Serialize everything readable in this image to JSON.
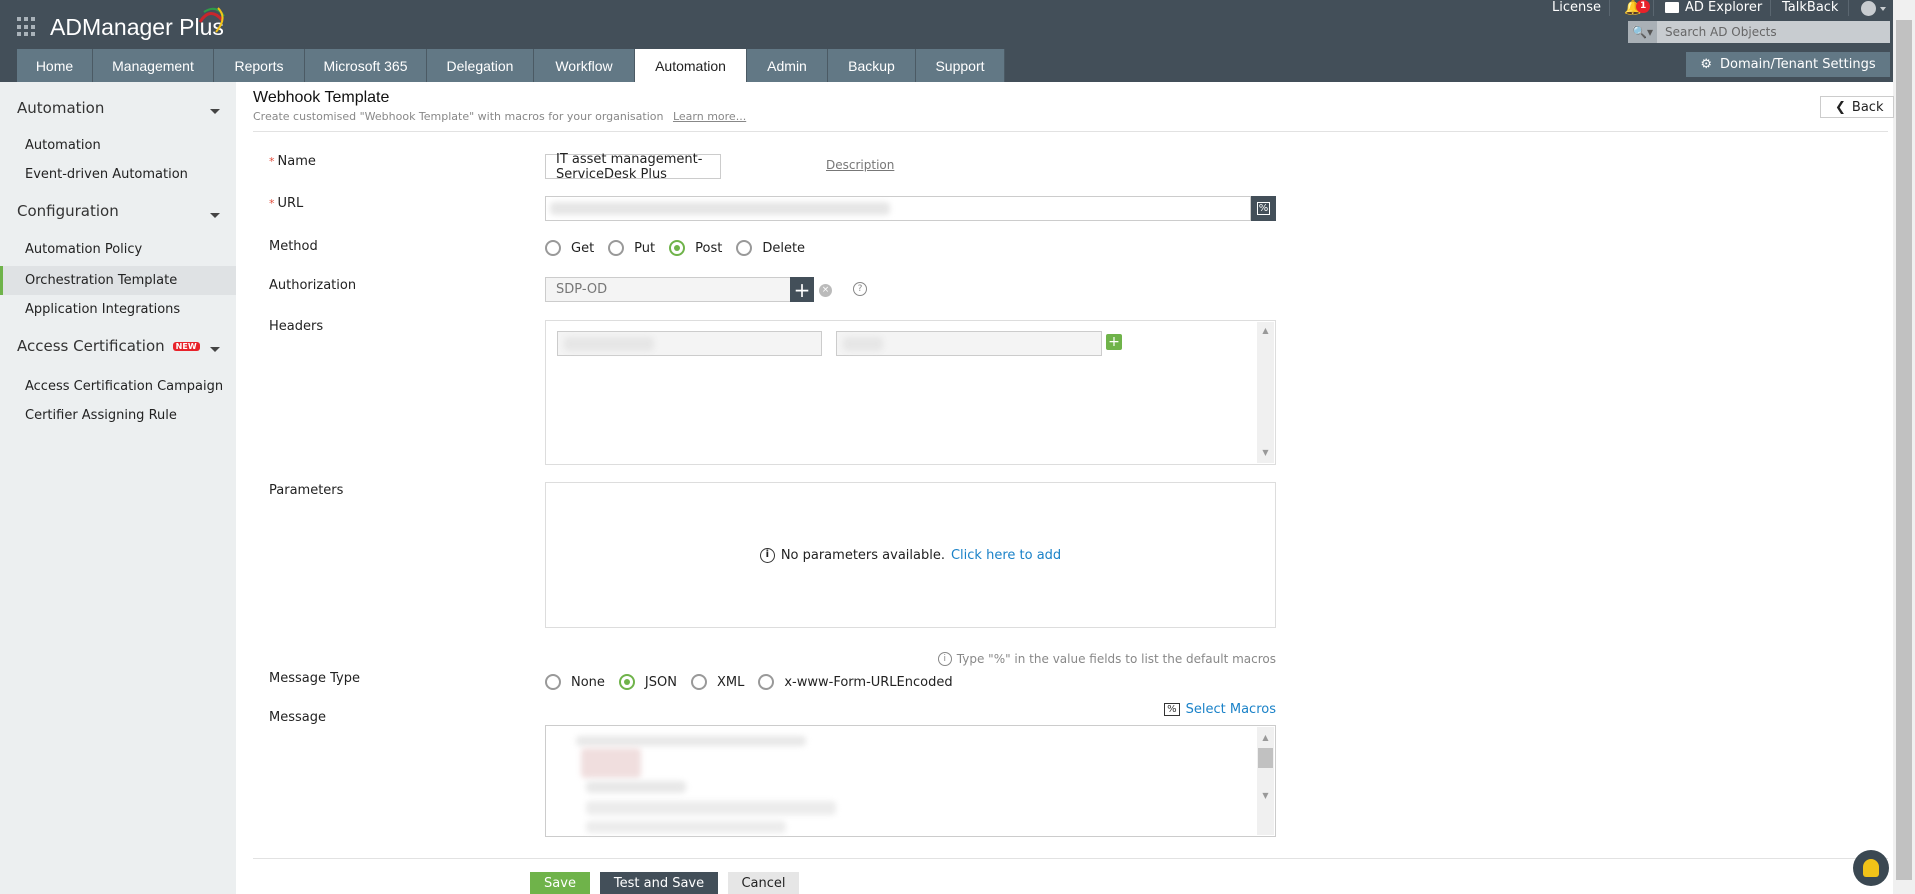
{
  "app": {
    "name": "ADManager Plus"
  },
  "top_links": {
    "license": "License",
    "notification_count": "1",
    "ad_explorer": "AD Explorer",
    "talkback": "TalkBack"
  },
  "search": {
    "placeholder": "Search AD Objects"
  },
  "domain_settings": "Domain/Tenant Settings",
  "tabs": [
    "Home",
    "Management",
    "Reports",
    "Microsoft 365",
    "Delegation",
    "Workflow",
    "Automation",
    "Admin",
    "Backup",
    "Support"
  ],
  "active_tab": "Automation",
  "sidebar": {
    "sections": [
      {
        "title": "Automation",
        "items": [
          "Automation",
          "Event-driven Automation"
        ]
      },
      {
        "title": "Configuration",
        "items": [
          "Automation Policy",
          "Orchestration Template",
          "Application Integrations"
        ]
      },
      {
        "title": "Access Certification",
        "badge": "NEW",
        "items": [
          "Access Certification Campaign",
          "Certifier Assigning Rule"
        ]
      }
    ],
    "active_item": "Orchestration Template"
  },
  "page": {
    "title": "Webhook Template",
    "subtitle": "Create customised \"Webhook Template\" with macros for your organisation",
    "learn_more": "Learn more...",
    "back": "Back"
  },
  "form": {
    "name_label": "Name",
    "name_value": "IT asset management-ServiceDesk Plus",
    "description_link": "Description",
    "url_label": "URL",
    "method_label": "Method",
    "methods": [
      "Get",
      "Put",
      "Post",
      "Delete"
    ],
    "method_selected": "Post",
    "authorization_label": "Authorization",
    "authorization_value": "SDP-OD",
    "headers_label": "Headers",
    "parameters_label": "Parameters",
    "no_params": "No parameters available.",
    "click_add": "Click here to add",
    "macro_tip": "Type \"%\" in the value fields to list the default macros",
    "message_type_label": "Message Type",
    "message_types": [
      "None",
      "JSON",
      "XML",
      "x-www-Form-URLEncoded"
    ],
    "message_type_selected": "JSON",
    "message_label": "Message",
    "select_macros": "Select Macros"
  },
  "buttons": {
    "save": "Save",
    "test_save": "Test and Save",
    "cancel": "Cancel"
  },
  "colors": {
    "header": "#434f59",
    "tab": "#627885",
    "accent": "#6fb34a",
    "link": "#1a82c8"
  }
}
